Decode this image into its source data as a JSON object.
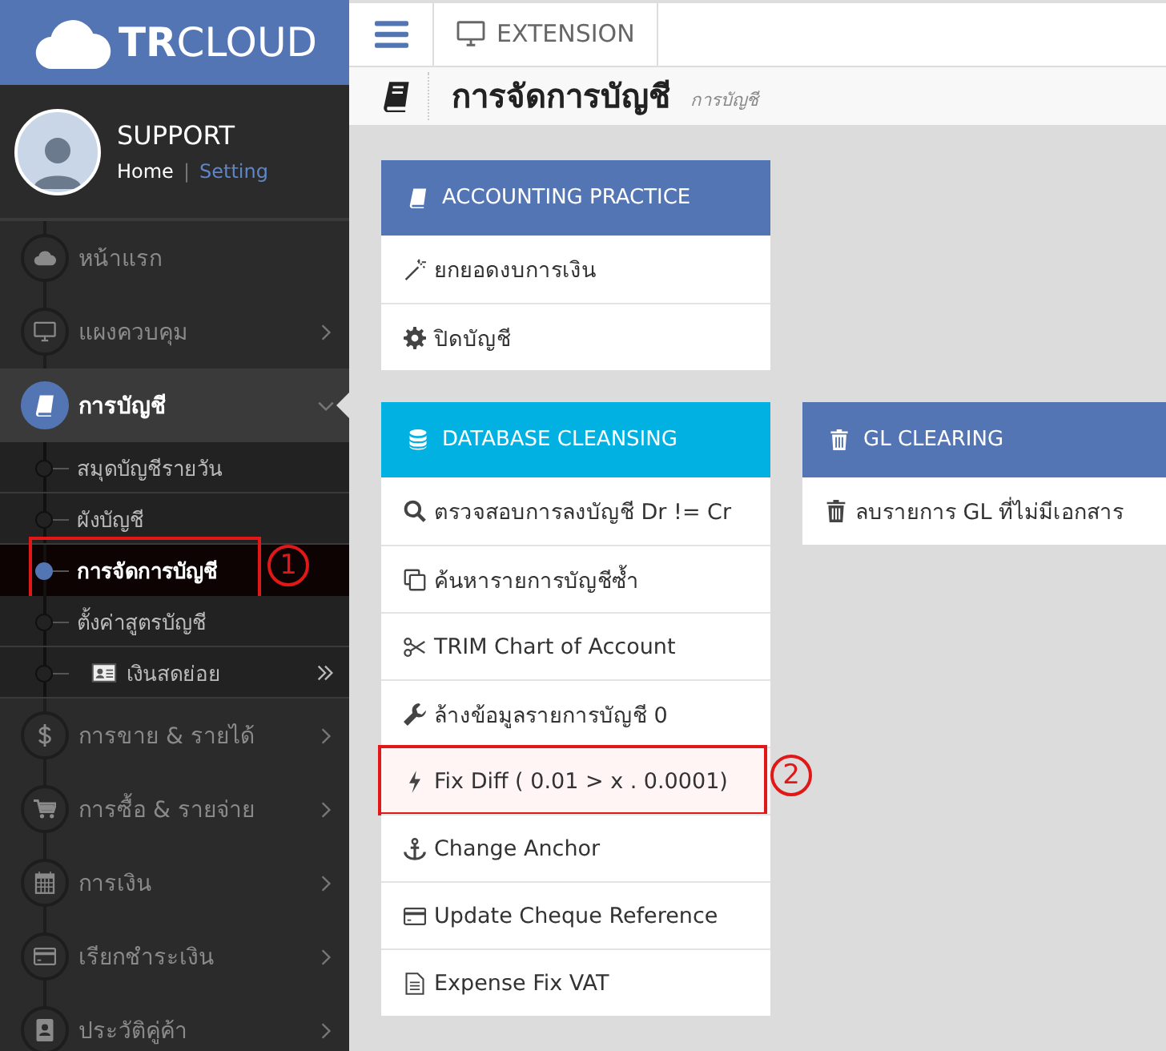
{
  "brand": {
    "logo": "**TR**CLOUD"
  },
  "profile": {
    "name": "SUPPORT",
    "links": [
      {
        "label": "Home",
        "active": true
      },
      {
        "label": "Setting",
        "active": false
      }
    ],
    "separator": "|"
  },
  "sidebar": {
    "items": [
      {
        "label": "หน้าแรก",
        "expandable": false,
        "selected": false
      },
      {
        "label": "แผงควบคุม",
        "expandable": true,
        "expanded": false,
        "selected": false
      },
      {
        "label": "การบัญชี",
        "expandable": true,
        "expanded": true,
        "selected": true,
        "children": [
          {
            "label": "สมุดบัญชีรายวัน",
            "expandable": false,
            "selected": false
          },
          {
            "label": "ผังบัญชี",
            "expandable": false,
            "selected": false
          },
          {
            "label": "การจัดการบัญชี",
            "expandable": false,
            "selected": true,
            "annotation": "1"
          },
          {
            "label": "ตั้งค่าสูตรบัญชี",
            "expandable": false,
            "selected": false
          },
          {
            "label": "เงินสดย่อย",
            "expandable": true,
            "selected": false
          }
        ]
      },
      {
        "label": "การขาย & รายได้",
        "expandable": true,
        "expanded": false,
        "selected": false
      },
      {
        "label": "การซื้อ & รายจ่าย",
        "expandable": true,
        "expanded": false,
        "selected": false
      },
      {
        "label": "การเงิน",
        "expandable": true,
        "expanded": false,
        "selected": false
      },
      {
        "label": "เรียกชำระเงิน",
        "expandable": true,
        "expanded": false,
        "selected": false
      },
      {
        "label": "ประวัติคู่ค้า",
        "expandable": true,
        "expanded": false,
        "selected": false
      }
    ]
  },
  "topbar": {
    "extension": "EXTENSION"
  },
  "page_header": {
    "title": "การจัดการบัญชี",
    "subtitle": "การบัญชี"
  },
  "rows": [
    {
      "panels": [
        {
          "title": "ACCOUNTING PRACTICE",
          "color": "#5475b3",
          "items": [
            {
              "label": "ยกยอดงบการเงิน"
            },
            {
              "label": "ปิดบัญชี"
            }
          ]
        }
      ]
    },
    {
      "panels": [
        {
          "title": "DATABASE CLEANSING",
          "color": "#00b1e1",
          "items": [
            {
              "label": "ตรวจสอบการลงบัญชี Dr != Cr"
            },
            {
              "label": "ค้นหารายการบัญชีซ้ำ"
            },
            {
              "label": "TRIM Chart of Account"
            },
            {
              "label": "ล้างข้อมูลรายการบัญชี 0"
            },
            {
              "label": "Fix Diff ( 0.01 > x . 0.0001)",
              "annotation": "2"
            },
            {
              "label": "Change Anchor"
            },
            {
              "label": "Update Cheque Reference"
            },
            {
              "label": "Expense Fix VAT"
            }
          ]
        },
        {
          "title": "GL CLEARING",
          "color": "#5475b3",
          "items": [
            {
              "label": "ลบรายการ GL ที่ไม่มีเอกสาร"
            }
          ]
        }
      ]
    }
  ]
}
